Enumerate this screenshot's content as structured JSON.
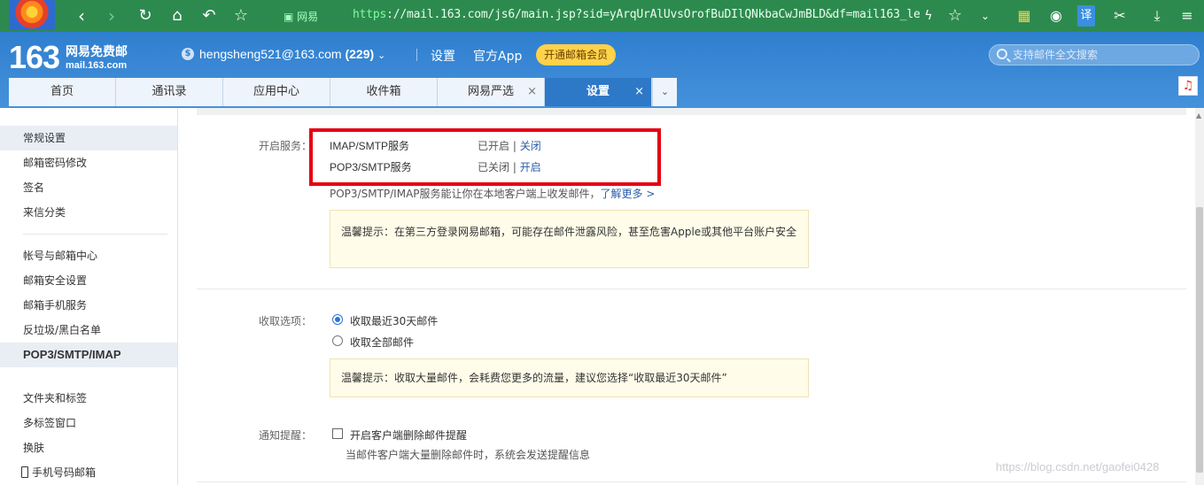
{
  "browser": {
    "secure_label": "网易",
    "url_scheme": "https",
    "url_rest": "://mail.163.com/js6/main.jsp?sid=yArqUrAlUvsOrofBuDIlQNkbaCwJmBLD&df=mail163_let"
  },
  "header": {
    "logo_number": "163",
    "logo_name": "网易免费邮",
    "logo_domain": "mail.163.com",
    "user_email": "hengsheng521@163.com",
    "unread_count": "(229)",
    "settings_link": "设置",
    "app_link": "官方App",
    "vip_button": "开通邮箱会员",
    "search_placeholder": "支持邮件全文搜索"
  },
  "tabs": [
    {
      "label": "首页"
    },
    {
      "label": "通讯录"
    },
    {
      "label": "应用中心"
    },
    {
      "label": "收件箱"
    },
    {
      "label": "网易严选",
      "closable": true
    },
    {
      "label": "设置",
      "closable": true,
      "active": true
    }
  ],
  "sidebar": {
    "groups": [
      [
        "常规设置",
        "邮箱密码修改",
        "签名",
        "来信分类"
      ],
      [
        "帐号与邮箱中心",
        "邮箱安全设置",
        "邮箱手机服务",
        "反垃圾/黑白名单",
        "POP3/SMTP/IMAP"
      ],
      [
        "文件夹和标签",
        "多标签窗口",
        "换肤",
        "手机号码邮箱"
      ]
    ],
    "selected": "POP3/SMTP/IMAP"
  },
  "settings": {
    "service_label": "开启服务：",
    "services": [
      {
        "name": "IMAP/SMTP服务",
        "status": "已开启",
        "sep": "|",
        "action": "关闭"
      },
      {
        "name": "POP3/SMTP服务",
        "status": "已关闭",
        "sep": "|",
        "action": "开启"
      }
    ],
    "service_desc": "POP3/SMTP/IMAP服务能让你在本地客户端上收发邮件，",
    "learn_more": "了解更多 >",
    "tip1": "温馨提示：在第三方登录网易邮箱，可能存在邮件泄露风险，甚至危害Apple或其他平台账户安全",
    "receive_label": "收取选项：",
    "receive_options": [
      "收取最近30天邮件",
      "收取全部邮件"
    ],
    "tip2": "温馨提示：收取大量邮件，会耗费您更多的流量，建议您选择“收取最近30天邮件”",
    "notify_label": "通知提醒：",
    "notify_option": "开启客户端删除邮件提醒",
    "notify_note": "当邮件客户端大量删除邮件时，系统会发送提醒信息"
  },
  "watermark": "https://blog.csdn.net/gaofei0428",
  "colors": {
    "browser_bar": "#2d8a4e",
    "header_blue": "#2f7fd0",
    "active_tab": "#2e78c8",
    "vip_yellow": "#ffd24a",
    "highlight_red": "#e60012",
    "link_blue": "#2a5caa"
  }
}
